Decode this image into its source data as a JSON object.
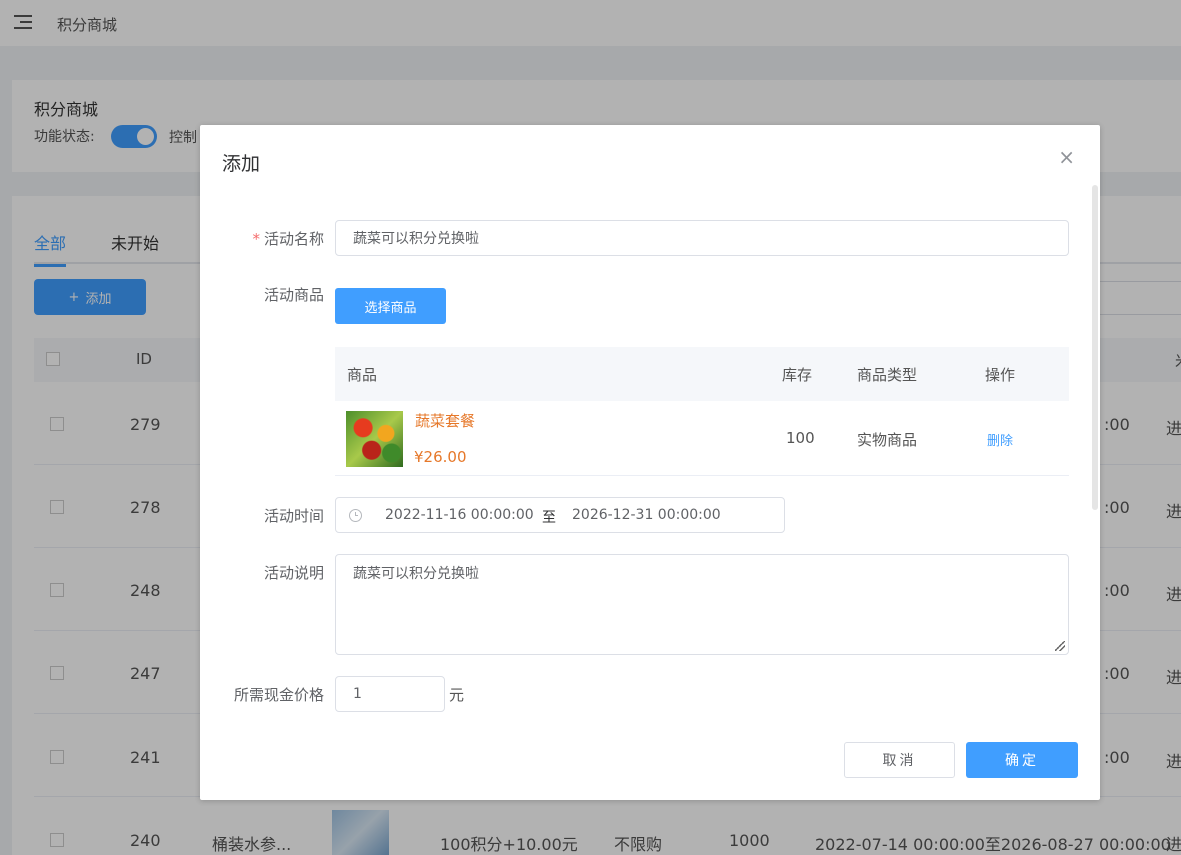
{
  "header": {
    "title": "积分商城"
  },
  "settings": {
    "title": "积分商城",
    "status_label": "功能状态:",
    "status_desc": "控制",
    "enabled": true
  },
  "tabs": [
    {
      "label": "全部",
      "active": true
    },
    {
      "label": "未开始",
      "active": false
    }
  ],
  "add_button": {
    "label": "添加"
  },
  "table": {
    "header_id": "ID",
    "header_right": "米",
    "rows": [
      {
        "id": "279",
        "time": ":00",
        "status": "进"
      },
      {
        "id": "278",
        "time": ":00",
        "status": "进"
      },
      {
        "id": "248",
        "time": ":00",
        "status": "进"
      },
      {
        "id": "247",
        "time": ":00",
        "status": "进"
      },
      {
        "id": "241",
        "time": ":00",
        "status": "进"
      }
    ],
    "last_row": {
      "id": "240",
      "name": "桶装水参...",
      "price": "100积分+10.00元",
      "limit": "不限购",
      "stock": "1000",
      "time": "2022-07-14 00:00:00至2026-08-27 00:00:00",
      "status": "进"
    }
  },
  "dialog": {
    "title": "添加",
    "close": "×",
    "activity_name": {
      "label": "活动名称",
      "required": "*",
      "value": "蔬菜可以积分兑换啦"
    },
    "activity_goods": {
      "label": "活动商品",
      "select_button": "选择商品"
    },
    "goods_table": {
      "headers": {
        "goods": "商品",
        "stock": "库存",
        "type": "商品类型",
        "action": "操作"
      },
      "rows": [
        {
          "name": "蔬菜套餐",
          "price": "¥26.00",
          "stock": "100",
          "type": "实物商品",
          "action": "删除"
        }
      ]
    },
    "activity_time": {
      "label": "活动时间",
      "start": "2022-11-16 00:00:00",
      "separator": "至",
      "end": "2026-12-31 00:00:00"
    },
    "activity_desc": {
      "label": "活动说明",
      "value": "蔬菜可以积分兑换啦"
    },
    "cash_price": {
      "label": "所需现金价格",
      "value": "1",
      "unit": "元"
    },
    "cancel_button": "取消",
    "confirm_button": "确定"
  },
  "colors": {
    "primary": "#409eff",
    "price": "#e6782a",
    "required": "#f56c6c"
  }
}
